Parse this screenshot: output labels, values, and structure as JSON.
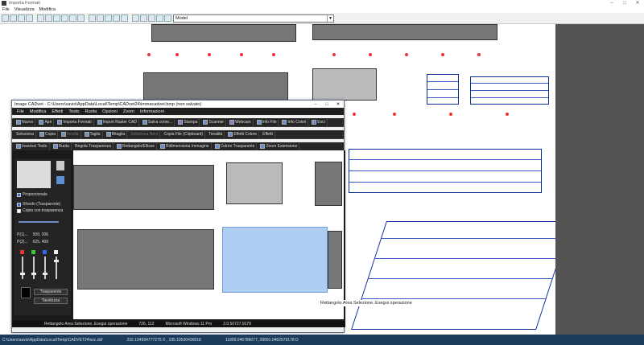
{
  "app": {
    "title": "Importa Formati"
  },
  "menu": [
    "File",
    "Visualizza",
    "Modifica"
  ],
  "toolbar": {
    "layout_select": "Model"
  },
  "window": {
    "title": "Image CADvet - C:\\Users\\savio\\AppData\\Local\\Temp\\CADvet24\\immacadvet.bmp (non salvato)",
    "menu": [
      "File",
      "Modifica",
      "Effetti",
      "Testo",
      "Ruota",
      "Opzioni",
      "Zoom",
      "Informazioni"
    ],
    "row1": [
      "Nuovo",
      "Apri",
      "Importa Formati",
      "Import Raster CAD",
      "Salva come...",
      "Stampa",
      "Scanner",
      "Webcam",
      "Info File",
      "Info Colori",
      "Esci"
    ],
    "row2": [
      "Seleziona",
      "Copia",
      "Incolla",
      "Taglia",
      "Ritaglia",
      "Seleziona Nero",
      "Copia File (Clipboard)",
      "Tonalità",
      "Effetti Colore",
      "Effetti"
    ],
    "row3": [
      "Inserisci Testo",
      "Ruota",
      "Regola Trasparenza",
      "Rettangolo/Ellisse",
      "Ridimensiona Immagine",
      "Colore Trasparente",
      "Zoom Estensione"
    ],
    "left": {
      "proporzionale": "Proporzionale",
      "sfondo": "Sfondo (Trasparente)",
      "copia": "Copia con trasparenza",
      "p1": "P(1)...",
      "p1v": "509, 206",
      "p2": "P(2)...",
      "p2v": "625, 409",
      "trasparente": "Trasparente",
      "tavolozza": "Tavolozza"
    },
    "status": {
      "text": "Rettangolo Area Selezione..Esegui operazione",
      "coords": "726, 112",
      "os": "Microsoft Windows 11 Pro",
      "ver": "2.0.50727.9179"
    }
  },
  "tooltip": "Rettangolo Area Selezione..Esegui operazione",
  "statusbar": {
    "path": "C:\\Users\\savio\\AppData\\Local\\Temp\\CADVET24\\svc.dxf",
    "coords1": "232.194934777275 X , 195.10530436018",
    "coords2": "11809.046786077, 39091.0462579178 D"
  }
}
